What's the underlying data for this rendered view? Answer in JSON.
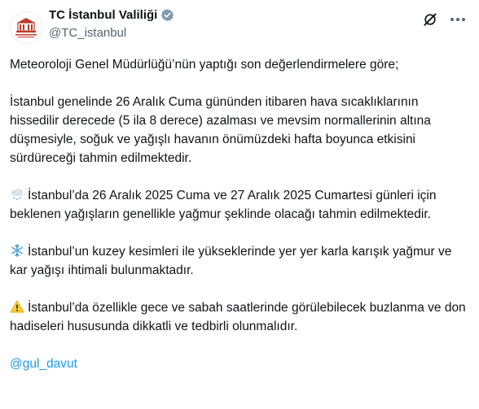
{
  "author": {
    "display_name": "TC İstanbul Valiliği",
    "handle": "@TC_istanbul",
    "avatar_caption": "T.C. İSTANBUL VALİLİĞİ",
    "verified_icon": "verified-badge-gray"
  },
  "icons": {
    "grok": "grok-icon",
    "more": "more-options-icon",
    "snow_cloud": "cloud-with-snow-emoji",
    "snowflake": "snowflake-emoji",
    "warning": "warning-emoji"
  },
  "colors": {
    "text": "#0f1419",
    "secondary": "#536471",
    "link": "#1d9bf0",
    "avatar_red": "#c0392b"
  },
  "post": {
    "intro": "Meteoroloji Genel Müdürlüğü’nün yaptığı son değerlendirmelere göre;",
    "p1": "İstanbul genelinde 26 Aralık Cuma gününden itibaren hava sıcaklıklarının hissedilir derecede (5 ila 8 derece) azalması ve mevsim normallerinin altına düşmesiyle, soğuk ve yağışlı havanın önümüzdeki hafta boyunca etkisini sürdüreceği tahmin edilmektedir.",
    "p2": "İstanbul’da 26 Aralık 2025 Cuma ve 27 Aralık 2025 Cumartesi günleri için beklenen yağışların genellikle yağmur şeklinde olacağı tahmin edilmektedir.",
    "p3": "İstanbul’un kuzey kesimleri ile yükseklerinde yer yer karla karışık yağmur ve kar yağışı ihtimali bulunmaktadır.",
    "p4": "İstanbul’da özellikle gece ve sabah saatlerinde görülebilecek buzlanma ve don hadiseleri hususunda dikkatli ve tedbirli olunmalıdır.",
    "mention": "@gul_davut"
  }
}
